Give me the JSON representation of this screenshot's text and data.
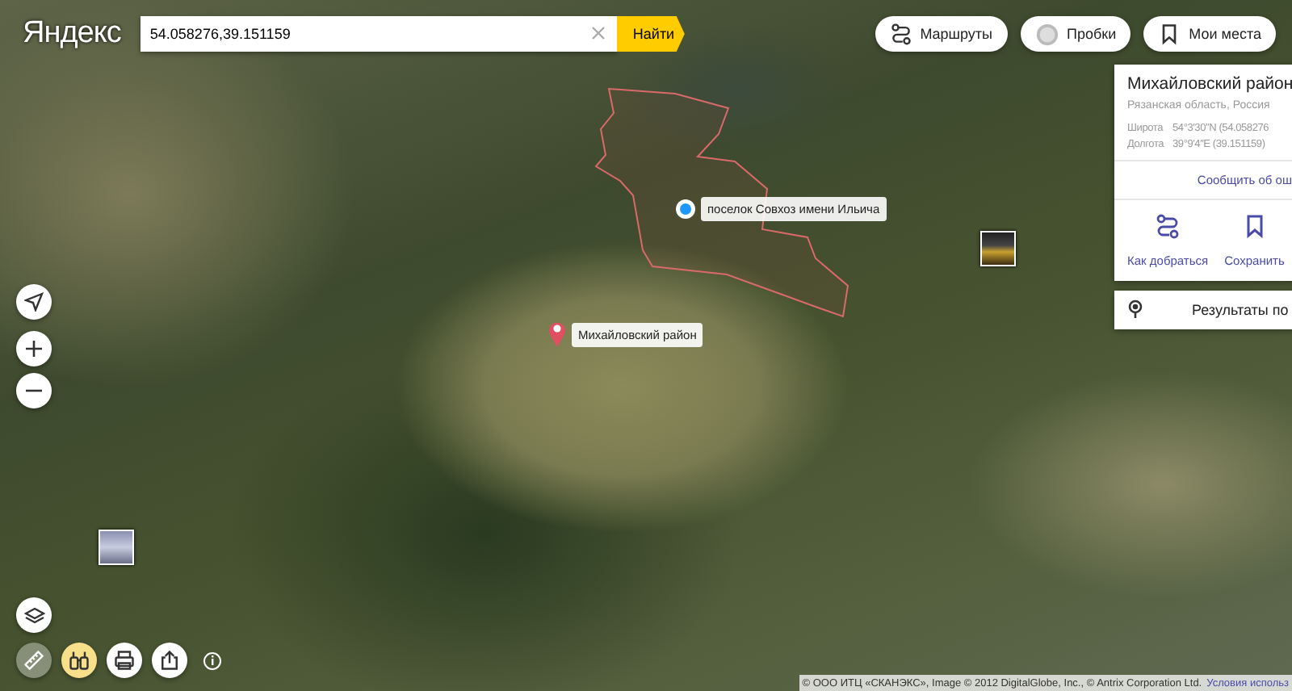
{
  "header": {
    "logo": "Яндекс",
    "search": {
      "value": "54.058276,39.151159"
    },
    "search_button": "Найти",
    "buttons": [
      {
        "label": "Маршруты",
        "kind": "routes"
      },
      {
        "label": "Пробки",
        "kind": "traffic"
      },
      {
        "label": "Мои места",
        "kind": "bookmark"
      }
    ]
  },
  "info_card": {
    "title": "Михайловский район",
    "subtitle": "Рязанская область, Россия",
    "coords": [
      {
        "label": "Широта",
        "value": "54°3′30″N (54.058276"
      },
      {
        "label": "Долгота",
        "value": "39°9′4″E (39.151159)"
      }
    ],
    "report_link": "Сообщить об ош",
    "actions": [
      {
        "label": "Как добраться",
        "kind": "route"
      },
      {
        "label": "Сохранить",
        "kind": "bookmark"
      }
    ]
  },
  "results_bar": "Результаты по",
  "map_labels": [
    {
      "text": "поселок Совхоз имени Ильича",
      "kind": "settlement"
    },
    {
      "text": "Михайловский район",
      "kind": "pin"
    }
  ],
  "tools": [
    {
      "kind": "ruler",
      "selected": false
    },
    {
      "kind": "panorama",
      "selected": true
    },
    {
      "kind": "print",
      "selected": false
    },
    {
      "kind": "share",
      "selected": false
    }
  ],
  "copyright": "© ООО ИТЦ «СКАНЭКС», Image © 2012 DigitalGlobe, Inc., © Antrix Corporation Ltd.",
  "terms_link": "Условия использ"
}
